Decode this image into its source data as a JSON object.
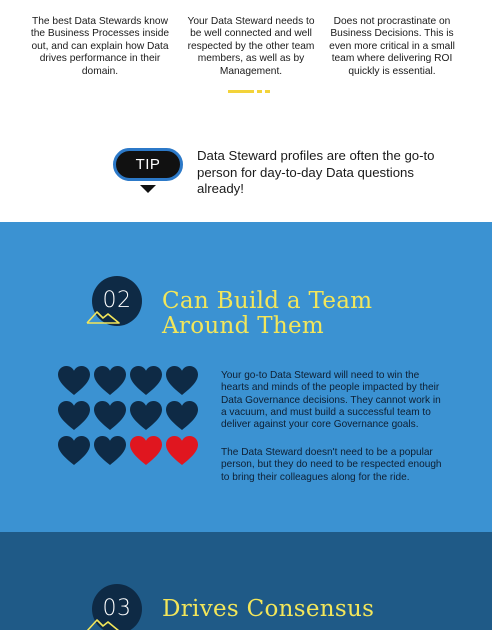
{
  "top": {
    "col1": "The best Data Stewards know the Business Processes inside out, and can explain how Data drives performance in their domain.",
    "col2": "Your Data Steward needs to be well connected and well respected by the other team members, as well as by Management.",
    "col3": "Does not procrastinate on Business Decisions. This is even more critical in a small team where delivering ROI quickly is essential.",
    "tip_label": "TIP",
    "tip_text": "Data Steward profiles are often the go-to person for day-to-day Data questions already!"
  },
  "section2": {
    "number": "02",
    "title_line1": "Can Build a Team",
    "title_line2": "Around Them",
    "paragraph1": "Your go-to Data Steward will need to win the hearts and minds of the people impacted by their Data Governance decisions. They cannot work in a vacuum, and must build a successful team to deliver against your core Governance goals.",
    "paragraph2": "The Data Steward doesn't need to be a popular person, but they do need to be respected enough to bring their colleagues along for the ride.",
    "hearts": {
      "total": 12,
      "highlighted": 2,
      "dark_color": "#0e2a45",
      "highlight_color": "#e0161f"
    }
  },
  "section3": {
    "number": "03",
    "title": "Drives Consensus"
  },
  "colors": {
    "blue_bg": "#3b92d2",
    "dark_bg": "#1f5a87",
    "accent_yellow": "#f3e65a",
    "tip_border": "#2c79c8"
  }
}
